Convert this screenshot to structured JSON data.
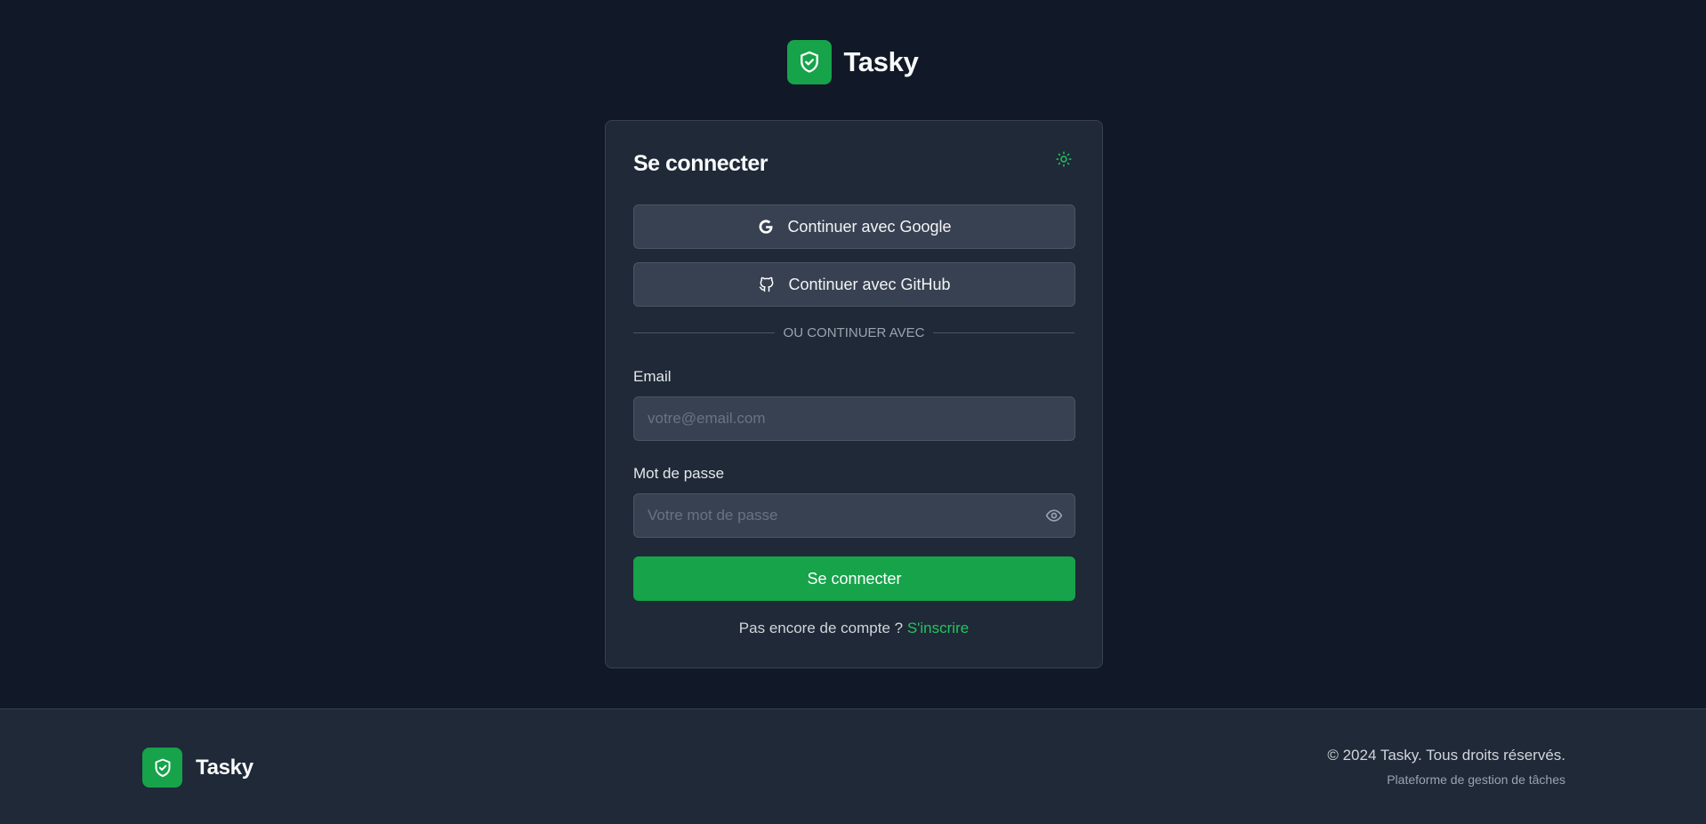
{
  "brand": {
    "name": "Tasky",
    "accent_color": "#16a34a",
    "logo_icon": "shield-check-icon"
  },
  "login": {
    "title": "Se connecter",
    "theme_toggle_icon": "sun-icon",
    "google_label": "Continuer avec Google",
    "github_label": "Continuer avec GitHub",
    "divider_text": "OU CONTINUER AVEC",
    "email_label": "Email",
    "email_value": "",
    "email_placeholder": "votre@email.com",
    "password_label": "Mot de passe",
    "password_value": "",
    "password_placeholder": "Votre mot de passe",
    "submit_label": "Se connecter",
    "signup_prompt": "Pas encore de compte ?",
    "signup_link": "S'inscrire"
  },
  "footer": {
    "brand_name": "Tasky",
    "copyright": "© 2024 Tasky. Tous droits réservés.",
    "tagline": "Plateforme de gestion de tâches"
  },
  "colors": {
    "background": "#111827",
    "card": "#1f2937",
    "input": "#374151",
    "link": "#22c55e"
  }
}
